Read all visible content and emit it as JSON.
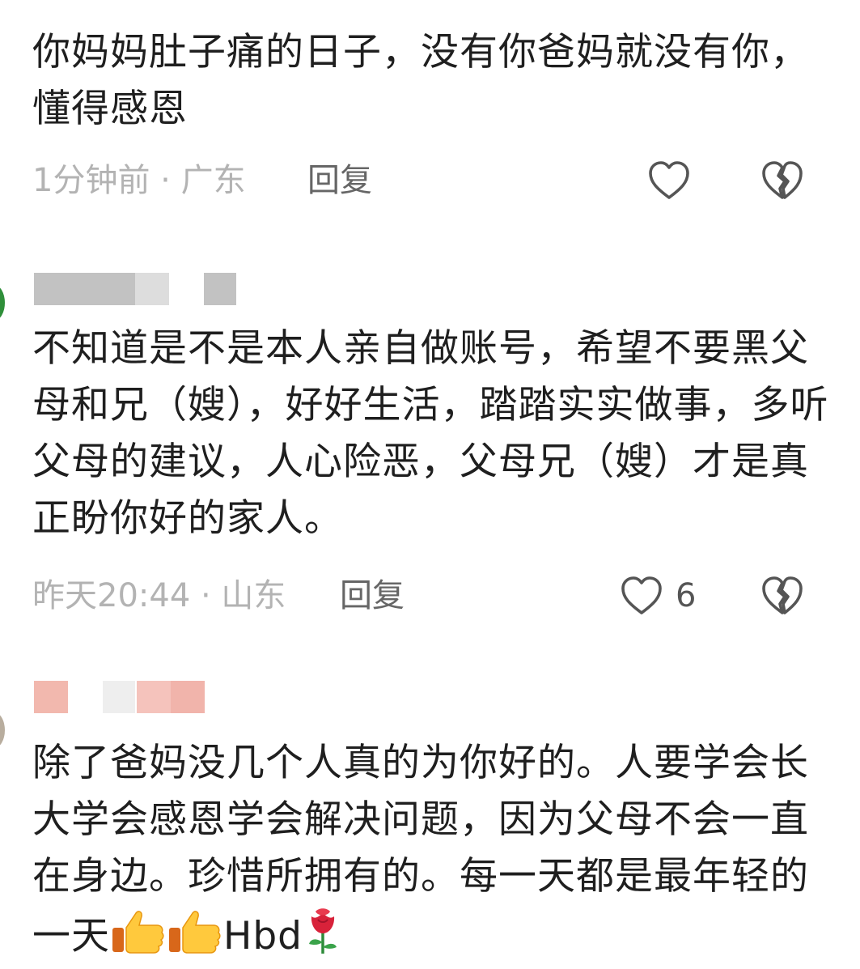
{
  "comments": [
    {
      "text": "你妈妈肚子痛的日子，没有你爸妈就没有你，懂得感恩",
      "meta": "1分钟前 · 广东",
      "reply": "回复",
      "likes": ""
    },
    {
      "text": "不知道是不是本人亲自做账号，希望不要黑父母和兄（嫂），好好生活，踏踏实实做事，多听父母的建议，人心险恶，父母兄（嫂）才是真正盼你好的家人。",
      "meta": "昨天20:44 · 山东",
      "reply": "回复",
      "likes": "6"
    },
    {
      "text": "除了爸妈没几个人真的为你好的。人要学会长大学会感恩学会解决问题，因为父母不会一直在身边。珍惜所拥有的。每一天都是最年轻的一天",
      "trailing_text": "Hbd",
      "emojis": [
        "thumbs-up",
        "thumbs-up",
        "rose"
      ]
    }
  ],
  "icons": {
    "like": "heart-outline",
    "dislike": "broken-heart-outline"
  },
  "colors": {
    "text": "#1f1f1f",
    "meta": "#b3b3b3",
    "reply": "#666666",
    "icon": "#555555"
  }
}
